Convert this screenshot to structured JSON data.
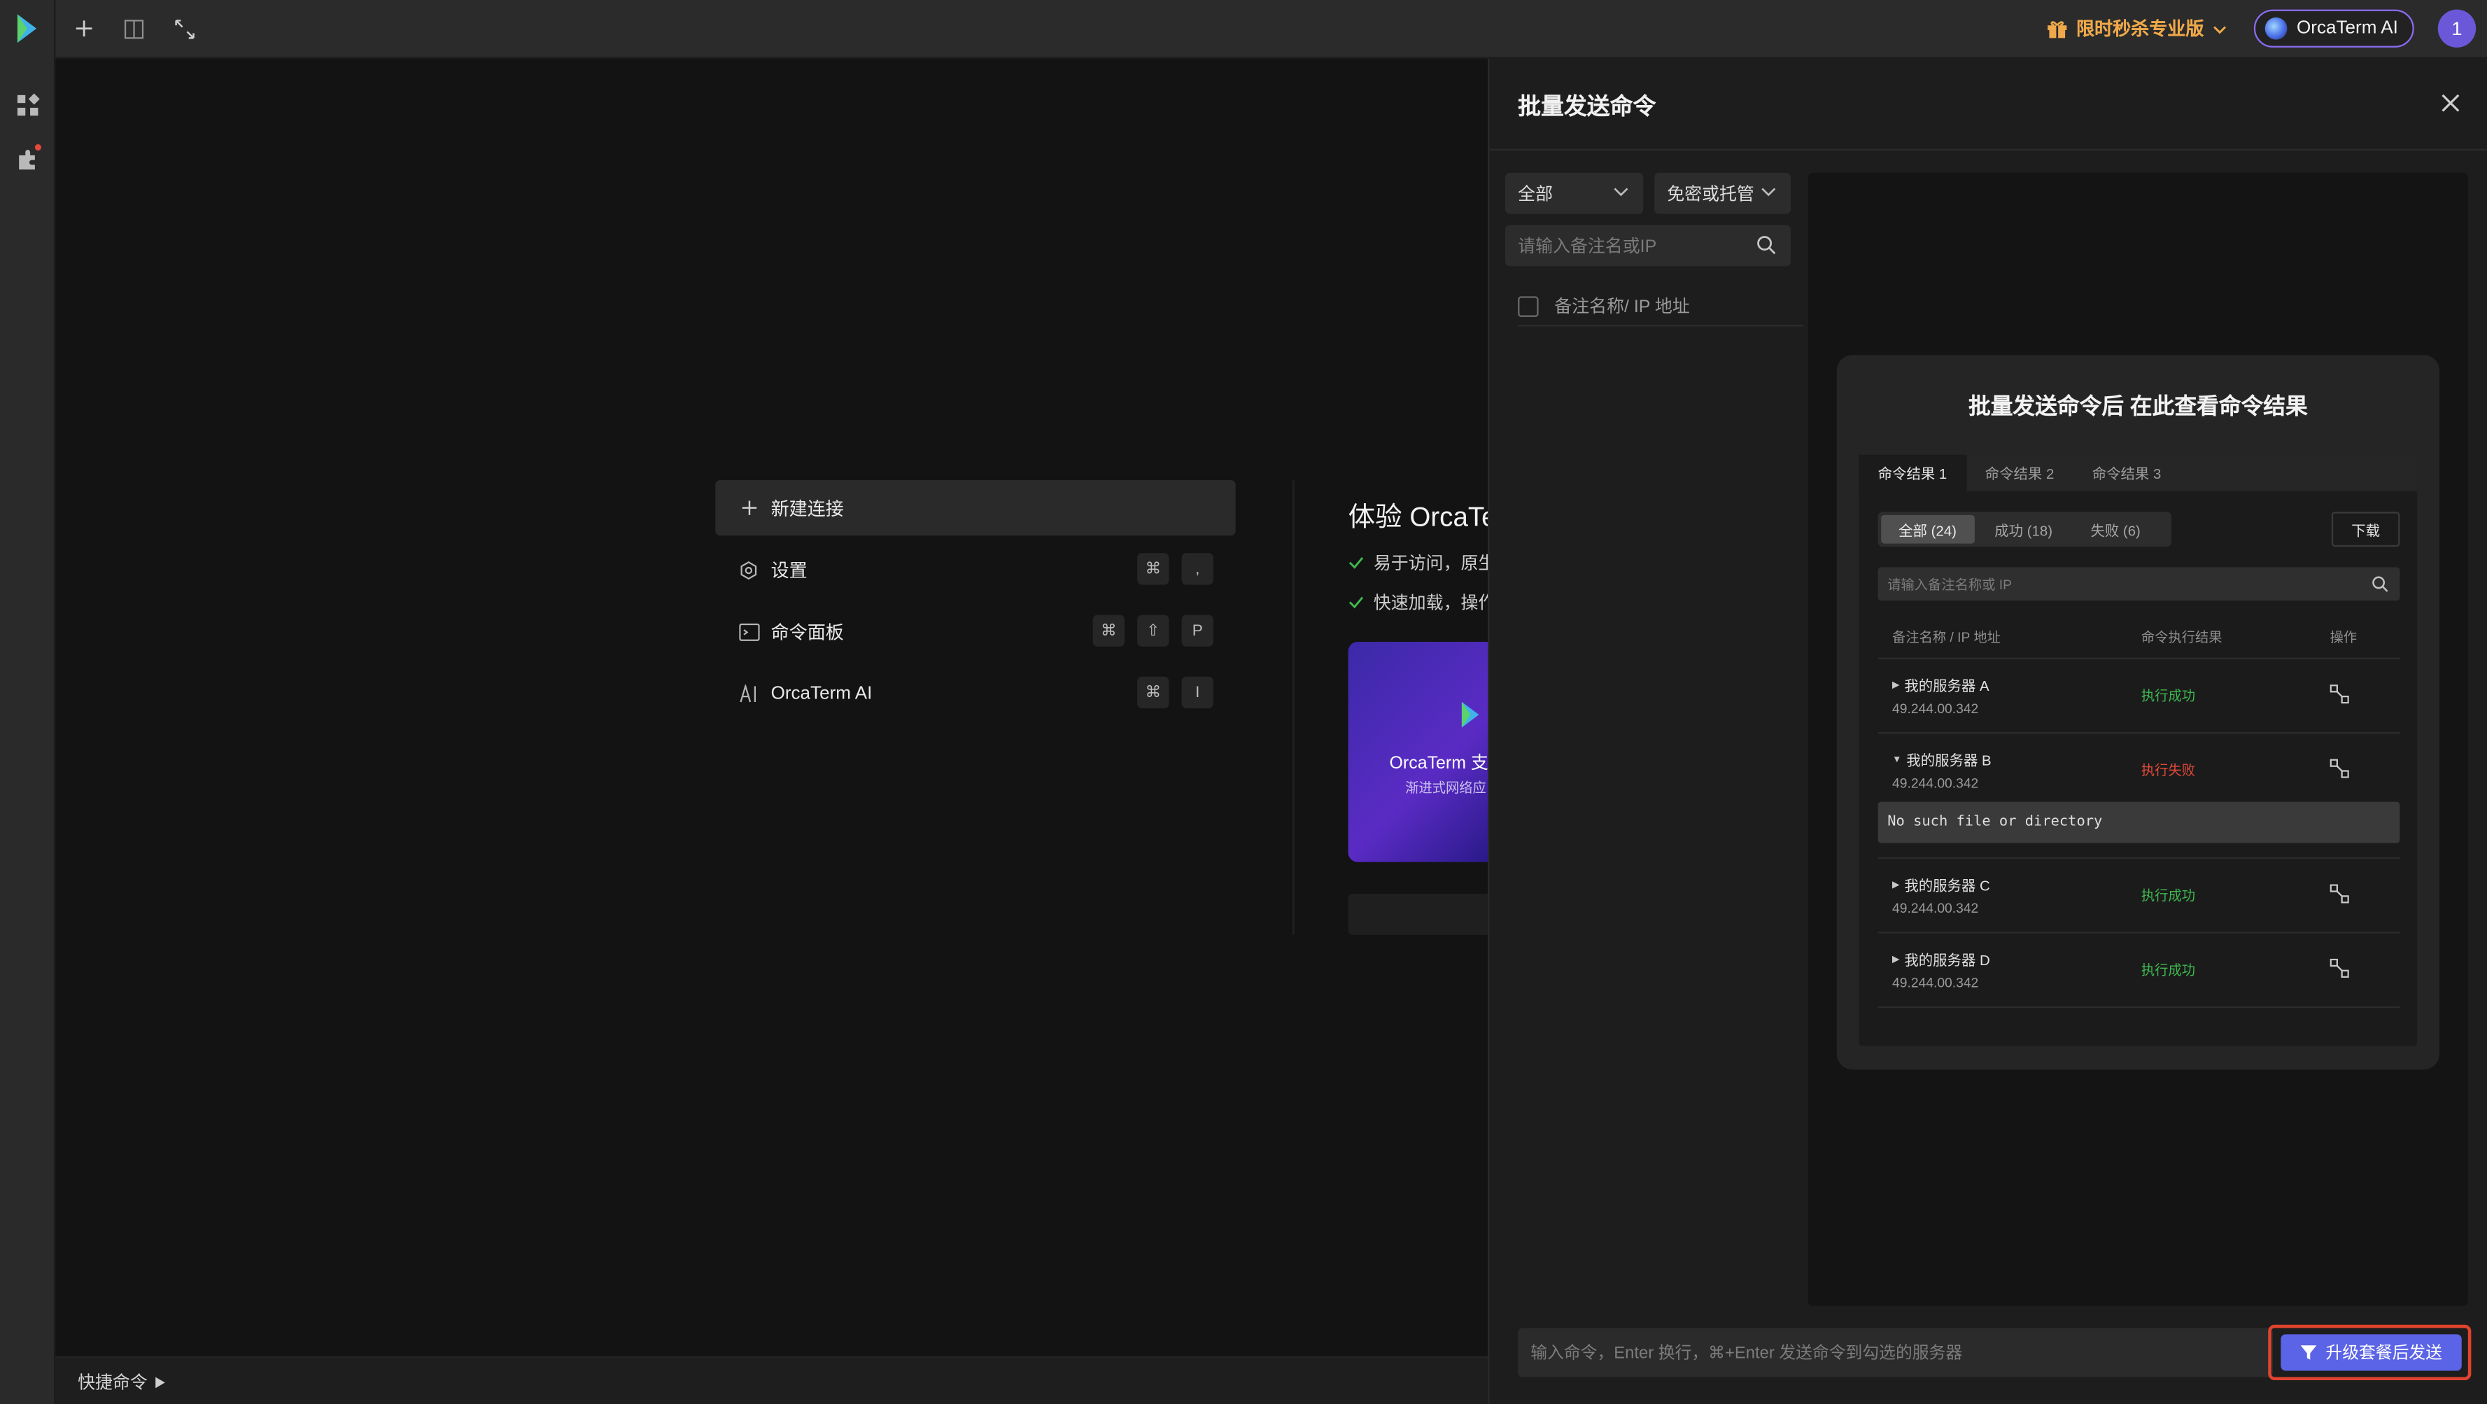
{
  "topbar": {
    "promo_label": "限时秒杀专业版",
    "ai_label": "OrcaTerm AI",
    "avatar_text": "1"
  },
  "menu": {
    "items": [
      {
        "label": "新建连接",
        "keys": []
      },
      {
        "label": "设置",
        "keys": [
          "⌘",
          ","
        ]
      },
      {
        "label": "命令面板",
        "keys": [
          "⌘",
          "⇧",
          "P"
        ]
      },
      {
        "label": "OrcaTerm AI",
        "keys": [
          "⌘",
          "I"
        ]
      }
    ]
  },
  "experience": {
    "title": "体验 OrcaTe",
    "lines": [
      "易于访问，原生",
      "快速加载，操作"
    ],
    "card_title": "OrcaTerm 支",
    "card_subtitle": "渐进式网络应"
  },
  "bottombar": {
    "quick_command": "快捷命令"
  },
  "drawer": {
    "title": "批量发送命令",
    "filter_all": "全部",
    "filter_auth": "免密或托管",
    "search_placeholder": "请输入备注名或IP",
    "list_header": "备注名称/ IP 地址",
    "illustration": {
      "title": "批量发送命令后 在此查看命令结果",
      "tabs": [
        "命令结果 1",
        "命令结果 2",
        "命令结果 3"
      ],
      "segments": [
        "全部 (24)",
        "成功 (18)",
        "失败 (6)"
      ],
      "download": "下载",
      "search_placeholder": "请输入备注名称或 IP",
      "columns": [
        "备注名称 / IP 地址",
        "命令执行结果",
        "操作"
      ],
      "rows": [
        {
          "name": "我的服务器 A",
          "ip": "49.244.00.342",
          "status": "执行成功",
          "expanded": false
        },
        {
          "name": "我的服务器 B",
          "ip": "49.244.00.342",
          "status": "执行失败",
          "expanded": true,
          "error": "No such file or directory"
        },
        {
          "name": "我的服务器 C",
          "ip": "49.244.00.342",
          "status": "执行成功",
          "expanded": false
        },
        {
          "name": "我的服务器 D",
          "ip": "49.244.00.342",
          "status": "执行成功",
          "expanded": false
        }
      ]
    },
    "command_placeholder": "输入命令，Enter 换行，⌘+Enter 发送命令到勾选的服务器",
    "send_label": "升级套餐后发送"
  },
  "colors": {
    "accent": "#5b63e6",
    "success": "#3fb950",
    "failure": "#e5493a",
    "promo": "#f0a94a",
    "highlight_border": "#e0432f"
  }
}
